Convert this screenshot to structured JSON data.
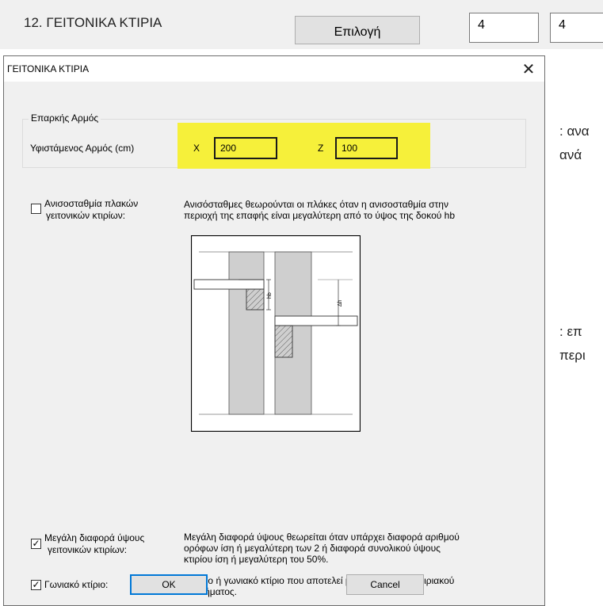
{
  "top": {
    "section_title": "12. ΓΕΙΤΟΝΙΚΑ ΚΤΙΡΙΑ",
    "select_button": "Επιλογή",
    "box1": "4",
    "box2": "4"
  },
  "side_text": {
    "line1": ": ανα",
    "line2": "ανά",
    "line3": ":   επ",
    "line4": "περι"
  },
  "dialog": {
    "title": "ΓΕΙΤΟΝΙΚΑ ΚΤΙΡΙΑ",
    "close": "✕",
    "group": {
      "legend": "Επαρκής Αρμός",
      "label": "Υφιστάμενος Αρμός (cm)",
      "x_label": "X",
      "x_value": "200",
      "z_label": "Z",
      "z_value": "100"
    },
    "options": [
      {
        "label_line1": "Ανισοσταθμία πλακών",
        "label_line2": "γειτονικών κτιρίων:",
        "checked": false,
        "desc_line1": "Ανισόσταθμες θεωρούνται οι πλάκες όταν η ανισοσταθμία στην",
        "desc_line2": "περιοχή της επαφής είναι μεγαλύτερη από το ύψος της δοκού hb",
        "desc_line3": ""
      },
      {
        "label_line1": "Μεγάλη διαφορά ύψους",
        "label_line2": "γειτονικών κτιρίων:",
        "checked": true,
        "desc_line1": "Μεγάλη διαφορά ύψους θεωρείται όταν υπάρχει διαφορά αριθμού",
        "desc_line2": "ορόφων ίση ή μεγαλύτερη των 2 ή διαφορά συνολικού ύψους",
        "desc_line3": "κτιρίου ίση ή μεγαλύτερη του 50%."
      },
      {
        "label_line1": "Γωνιακό κτίριο:",
        "label_line2": "",
        "checked": true,
        "desc_line1": "Ακραίο ή γωνιακό κτίριο που αποτελεί μέρος συνεχούς κτιριακού",
        "desc_line2": "συστήματος.",
        "desc_line3": ""
      }
    ],
    "diagram_labels": {
      "hb": "hb",
      "dh": "Δh"
    },
    "ok_button": "OK",
    "cancel_button": "Cancel"
  },
  "colors": {
    "highlight": "#f6f03a",
    "ok_border": "#0078d7"
  }
}
